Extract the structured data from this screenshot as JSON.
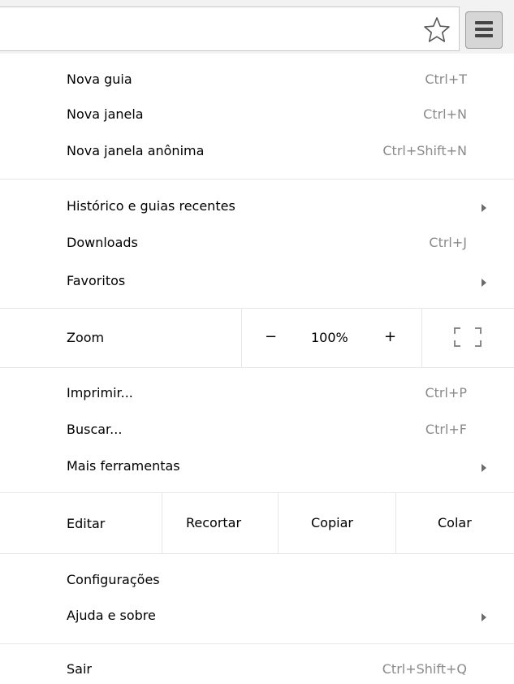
{
  "menu": {
    "new_tab": {
      "label": "Nova guia",
      "shortcut": "Ctrl+T"
    },
    "new_window": {
      "label": "Nova janela",
      "shortcut": "Ctrl+N"
    },
    "incognito": {
      "label": "Nova janela anônima",
      "shortcut": "Ctrl+Shift+N"
    },
    "history": {
      "label": "Histórico e guias recentes"
    },
    "downloads": {
      "label": "Downloads",
      "shortcut": "Ctrl+J"
    },
    "bookmarks": {
      "label": "Favoritos"
    },
    "zoom": {
      "label": "Zoom",
      "minus": "−",
      "value": "100%",
      "plus": "+"
    },
    "print": {
      "label": "Imprimir...",
      "shortcut": "Ctrl+P"
    },
    "find": {
      "label": "Buscar...",
      "shortcut": "Ctrl+F"
    },
    "more_tools": {
      "label": "Mais ferramentas"
    },
    "edit": {
      "label": "Editar",
      "cut": "Recortar",
      "copy": "Copiar",
      "paste": "Colar"
    },
    "settings": {
      "label": "Configurações"
    },
    "help": {
      "label": "Ajuda e sobre"
    },
    "exit": {
      "label": "Sair",
      "shortcut": "Ctrl+Shift+Q"
    }
  },
  "icons": {
    "bookmark": "star-icon",
    "menu": "hamburger-menu-icon",
    "fullscreen": "fullscreen-icon",
    "submenu": "chevron-right-icon"
  },
  "colors": {
    "shortcut_text": "#8a8a8a",
    "separator": "#e6e6e6",
    "toolbar": "#f2f2f2"
  }
}
